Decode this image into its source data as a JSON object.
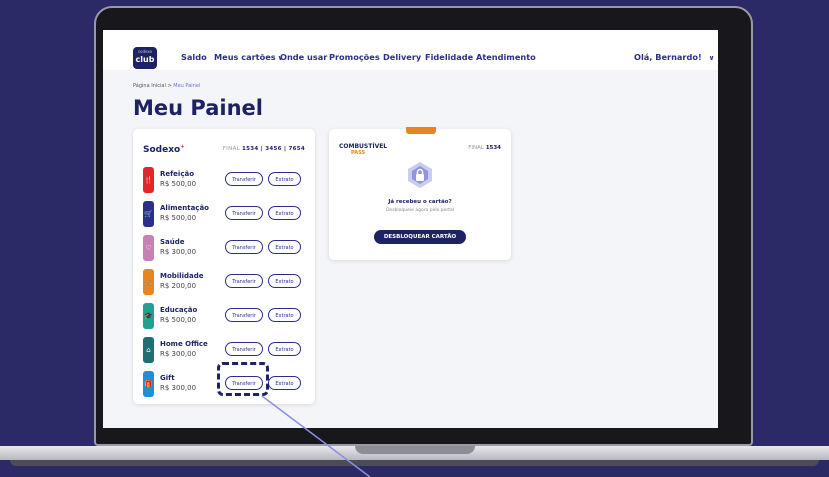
{
  "header": {
    "logo_top": "sodexo",
    "logo_text": "club",
    "nav": [
      "Saldo",
      "Meus cartões",
      "Onde usar",
      "Promoções",
      "Delivery",
      "Fidelidade",
      "Atendimento"
    ],
    "greeting": "Olá, Bernardo!"
  },
  "breadcrumb": {
    "home": "Página Inicial",
    "separator": ">",
    "current": "Meu Painel"
  },
  "page_title": "Meu Painel",
  "sodexo_card": {
    "brand": "Sodexo",
    "brand_mark": "+",
    "final_label": "FINAL",
    "final_numbers": "1534 | 3456 | 7654",
    "transfer_label": "Transferir",
    "statement_label": "Extrato",
    "benefits": [
      {
        "name": "Refeição",
        "value": "R$ 500,00",
        "color": "#e3262c",
        "icon": "fork-knife-icon"
      },
      {
        "name": "Alimentação",
        "value": "R$ 500,00",
        "color": "#2b2f8a",
        "icon": "cart-icon"
      },
      {
        "name": "Saúde",
        "value": "R$ 300,00",
        "color": "#c97fb3",
        "icon": "heart-icon"
      },
      {
        "name": "Mobilidade",
        "value": "R$ 200,00",
        "color": "#e9841f",
        "icon": "bike-icon"
      },
      {
        "name": "Educação",
        "value": "R$ 500,00",
        "color": "#1fa28f",
        "icon": "graduation-icon"
      },
      {
        "name": "Home Office",
        "value": "R$ 300,00",
        "color": "#1e6e72",
        "icon": "home-icon"
      },
      {
        "name": "Gift",
        "value": "R$ 300,00",
        "color": "#1e8fd6",
        "icon": "gift-icon"
      }
    ]
  },
  "fuel_card": {
    "brand_top": "COMBUSTÍVEL",
    "brand_bottom": "PASS",
    "final_label": "FINAL",
    "final_number": "1534",
    "question": "Já recebeu o cartão?",
    "sub": "Desbloqueie agora pelo portal",
    "unlock_label": "DESBLOQUEAR CARTÃO"
  },
  "colors": {
    "brand_dark": "#1d2262",
    "brand_accent": "#2b2f8a",
    "background": "#2c2a66"
  }
}
